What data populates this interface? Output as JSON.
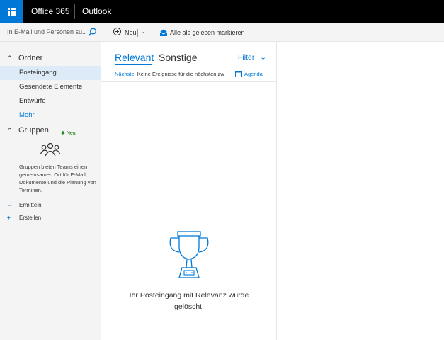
{
  "topbar": {
    "brand": "Office 365",
    "app_name": "Outlook",
    "waffle_icon": "app-launcher-icon",
    "accent_color": "#0078d7"
  },
  "search": {
    "placeholder": "In E-Mail und Personen su...",
    "icon": "search-icon"
  },
  "folders_section": {
    "label": "Ordner",
    "items": [
      "Posteingang",
      "Gesendete Elemente",
      "Entwürfe"
    ],
    "selected": "Posteingang",
    "more_label": "Mehr"
  },
  "groups_section": {
    "label": "Gruppen",
    "new_badge": "Neu",
    "description": "Gruppen bieten Teams einen gemeinsamen Ort für E-Mail, Dokumente und die Planung von Terminen.",
    "actions": [
      {
        "label": "Ermitteln",
        "icon": "arrow-right-icon"
      },
      {
        "label": "Erstellen",
        "icon": "plus-icon"
      }
    ]
  },
  "commandbar": {
    "new_label": "Neu",
    "mark_all_read_label": "Alle als gelesen markieren"
  },
  "messagelist": {
    "tabs": [
      "Relevant",
      "Sonstige"
    ],
    "active_tab": "Relevant",
    "filter_label": "Filter",
    "next_label": "Nächste:",
    "next_text": "Keine Ereignisse für die nächsten zw",
    "agenda_label": "Agenda",
    "empty_message": "Ihr Posteingang mit Relevanz wurde gelöscht."
  }
}
